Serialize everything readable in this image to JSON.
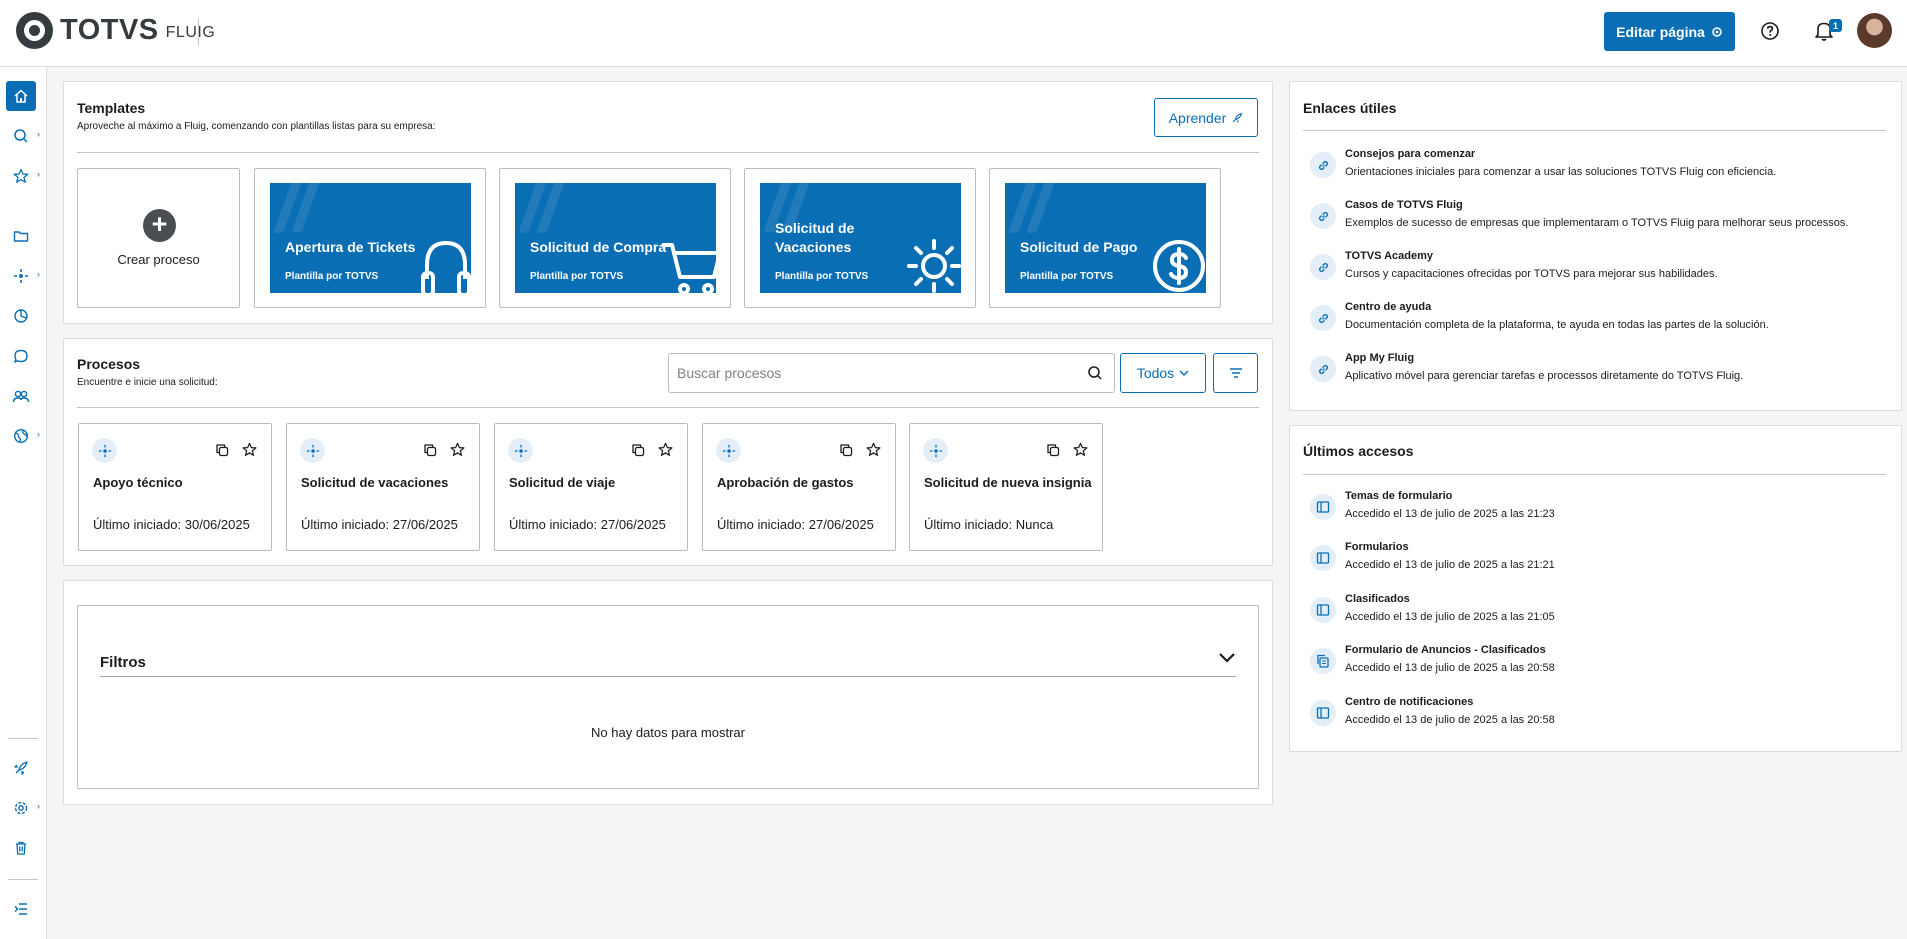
{
  "header": {
    "brand": "TOTVS",
    "brand_sub": "FLUIG",
    "edit_page_label": "Editar página",
    "notification_count": "1",
    "icons": {
      "help": "help-circle-icon",
      "bell": "bell-icon",
      "edit": "settings-sparkle-icon"
    }
  },
  "sidebar": {
    "items": [
      {
        "icon": "home-icon",
        "active": true,
        "has_arrow": false
      },
      {
        "icon": "search-icon",
        "active": false,
        "has_arrow": true
      },
      {
        "icon": "star-icon",
        "active": false,
        "has_arrow": true
      },
      {
        "icon": "folder-icon",
        "active": false,
        "has_arrow": false
      },
      {
        "icon": "process-icon",
        "active": false,
        "has_arrow": true
      },
      {
        "icon": "chart-icon",
        "active": false,
        "has_arrow": false
      },
      {
        "icon": "chat-icon",
        "active": false,
        "has_arrow": false
      },
      {
        "icon": "users-icon",
        "active": false,
        "has_arrow": false
      },
      {
        "icon": "globe-icon",
        "active": false,
        "has_arrow": true
      }
    ],
    "bottom_items": [
      {
        "icon": "rocket-icon",
        "has_arrow": false
      },
      {
        "icon": "gear-icon",
        "has_arrow": true
      },
      {
        "icon": "trash-icon",
        "has_arrow": false
      }
    ],
    "collapse_icon": "menu-collapse-icon"
  },
  "templates": {
    "title": "Templates",
    "subtitle": "Aproveche al máximo a Fluig, comenzando con plantillas listas para su empresa:",
    "learn_button": "Aprender",
    "create_label": "Crear proceso",
    "cards": [
      {
        "title": "Apertura de Tickets",
        "by": "Plantilla por TOTVS",
        "icon": "headphones-icon"
      },
      {
        "title": "Solicitud de Compra",
        "by": "Plantilla por TOTVS",
        "icon": "cart-icon"
      },
      {
        "title": "Solicitud de Vacaciones",
        "by": "Plantilla por TOTVS",
        "icon": "sun-icon"
      },
      {
        "title": "Solicitud de Pago",
        "by": "Plantilla por TOTVS",
        "icon": "dollar-icon"
      }
    ],
    "colors": {
      "card_blue": "#0a6eb4"
    }
  },
  "processes": {
    "title": "Procesos",
    "subtitle": "Encuentre e inicie una solicitud:",
    "search_placeholder": "Buscar procesos",
    "filter_select": "Todos",
    "cards": [
      {
        "name": "Apoyo técnico",
        "last": "Último iniciado: 30/06/2025"
      },
      {
        "name": "Solicitud de vacaciones",
        "last": "Último iniciado: 27/06/2025"
      },
      {
        "name": "Solicitud de viaje",
        "last": "Último iniciado: 27/06/2025"
      },
      {
        "name": "Aprobación de gastos",
        "last": "Último iniciado: 27/06/2025"
      },
      {
        "name": "Solicitud de nueva insignia",
        "last": "Último iniciado: Nunca"
      }
    ]
  },
  "filters": {
    "title": "Filtros",
    "empty": "No hay datos para mostrar"
  },
  "useful_links": {
    "title": "Enlaces útiles",
    "items": [
      {
        "title": "Consejos para comenzar",
        "desc": "Orientaciones iniciales para comenzar a usar las soluciones TOTVS Fluig con eficiencia."
      },
      {
        "title": "Casos de TOTVS Fluig",
        "desc": "Exemplos de sucesso de empresas que implementaram o TOTVS Fluig para melhorar seus processos."
      },
      {
        "title": "TOTVS Academy",
        "desc": "Cursos y capacitaciones ofrecidas por TOTVS para mejorar sus habilidades."
      },
      {
        "title": "Centro de ayuda",
        "desc": "Documentación completa de la plataforma, te ayuda en todas las partes de la solución."
      },
      {
        "title": "App My Fluig",
        "desc": "Aplicativo móvel para gerenciar tarefas e processos diretamente do TOTVS Fluig."
      }
    ]
  },
  "recent": {
    "title": "Últimos accesos",
    "items": [
      {
        "title": "Temas de formulario",
        "desc": "Accedido el 13 de julio de 2025 a las 21:23",
        "icon": "page-icon"
      },
      {
        "title": "Formularios",
        "desc": "Accedido el 13 de julio de 2025 a las 21:21",
        "icon": "page-icon"
      },
      {
        "title": "Clasificados",
        "desc": "Accedido el 13 de julio de 2025 a las 21:05",
        "icon": "page-icon"
      },
      {
        "title": "Formulario de Anuncios - Clasificados",
        "desc": "Accedido el 13 de julio de 2025 a las 20:58",
        "icon": "document-icon"
      },
      {
        "title": "Centro de notificaciones",
        "desc": "Accedido el 13 de julio de 2025 a las 20:58",
        "icon": "page-icon"
      }
    ]
  }
}
